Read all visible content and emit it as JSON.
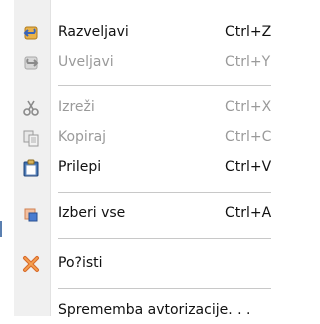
{
  "menu": {
    "items": [
      {
        "label": "Razveljavi",
        "shortcut": "Ctrl+Z",
        "icon": "undo-icon",
        "enabled": true
      },
      {
        "label": "Uveljavi",
        "shortcut": "Ctrl+Y",
        "icon": "redo-icon",
        "enabled": false
      },
      {
        "label": "Izreži",
        "shortcut": "Ctrl+X",
        "icon": "cut-icon",
        "enabled": false
      },
      {
        "label": "Kopiraj",
        "shortcut": "Ctrl+C",
        "icon": "copy-icon",
        "enabled": false
      },
      {
        "label": "Prilepi",
        "shortcut": "Ctrl+V",
        "icon": "paste-icon",
        "enabled": true
      },
      {
        "label": "Izberi vse",
        "shortcut": "Ctrl+A",
        "icon": "select-all-icon",
        "enabled": true
      },
      {
        "label": "Po?isti",
        "shortcut": "",
        "icon": "clear-icon",
        "enabled": true
      },
      {
        "label": "Sprememba avtorizacije. . .",
        "shortcut": "",
        "icon": "",
        "enabled": true
      }
    ]
  },
  "colors": {
    "gutter": "#f0f0f0",
    "separator": "#c8c8c8",
    "disabled_text": "#9a9a9a"
  }
}
